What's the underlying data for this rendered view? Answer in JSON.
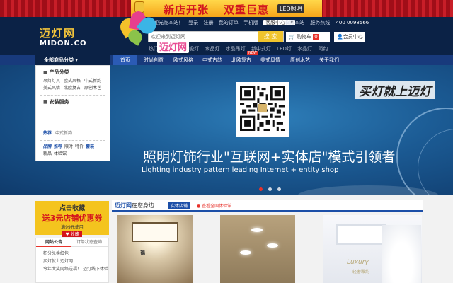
{
  "banner": {
    "text1": "新店开张",
    "text2": "双重巨惠",
    "badge": "LED照明"
  },
  "header": {
    "logo_cn": "迈灯网",
    "logo_en": "MIDON.CO",
    "top_links": [
      "欢迎光临本站！",
      "登录",
      "注册",
      "我的订单",
      "手机版"
    ],
    "service_label": "客服中心",
    "right_links": [
      "收藏本站",
      "服务热线"
    ],
    "phone": "400 0098566",
    "search_placeholder": "欢迎来到迈灯网",
    "search_button": "搜 索",
    "hot_label": "热门搜索：",
    "hot_words": [
      "欧式吸灯",
      "水晶灯",
      "水晶吊灯",
      "新中式灯",
      "LED灯",
      "水晶灯",
      "简约"
    ],
    "cart_label": "购物车",
    "cart_count": "0",
    "member_label": "会员中心"
  },
  "nav": {
    "all_categories": "全部商品分类",
    "items": [
      "首页",
      "时尚创意",
      "欧式风格",
      "中式古韵",
      "北欧复古",
      "美式风情",
      "原创木艺",
      "关于我们"
    ],
    "new_badge": "NEW"
  },
  "sidebar": {
    "section1_title": "产品分类",
    "section1_links": [
      "吊灯灯具",
      "欧式风格",
      "中式新韵",
      "美式风情",
      "北欧复古",
      "原创木艺"
    ],
    "section2_title": "安装服务",
    "hot_label": "热荐",
    "hot_links": [
      "中式新韵"
    ],
    "links_row1": [
      "品牌",
      "推荐",
      "限时",
      "特价",
      "套装"
    ],
    "links_row2": [
      "新品",
      "体验馆"
    ]
  },
  "hero": {
    "logo_text": "迈灯网",
    "slogan": "买灯就上迈灯",
    "tagline_cn": "照明灯饰行业\"互联网+实体店\"模式引领者",
    "tagline_en": "Lighting industry pattern leading Internet + entity shop",
    "slides": 3,
    "active_slide": 1
  },
  "promo": {
    "line1": "点击收藏",
    "line2": "送3元店铺优惠券",
    "line3": "满99元使用",
    "button": "收藏"
  },
  "news": {
    "tabs": [
      "网站公告",
      "订单状态查询"
    ],
    "items": [
      "积分兑换红包",
      "买灯就上迈灯网",
      "今年大奖网络送福！",
      "迈灯线下体验"
    ]
  },
  "products": {
    "title_brand": "迈灯网",
    "title_rest": "在您身边",
    "tag": "实体店铺",
    "location": "查看全国体验馆",
    "card1_text": "福",
    "luxury_text": "Luxury",
    "luxury_sub": "轻奢雅韵"
  },
  "colors": {
    "brand_blue": "#0b2246",
    "nav_blue": "#183a7c",
    "accent_yellow": "#f0c42d",
    "accent_red": "#e8322b"
  }
}
